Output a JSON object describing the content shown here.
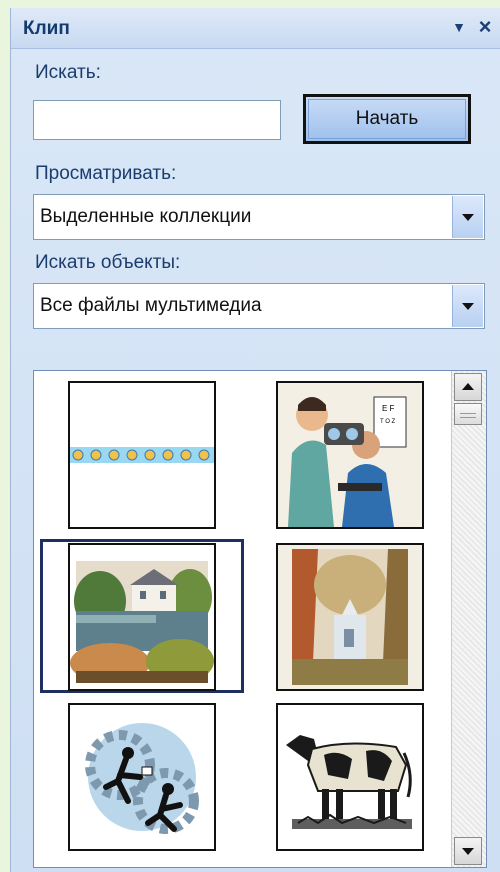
{
  "pane": {
    "title": "Клип",
    "menu_icon": "dropdown-triangle-icon",
    "close_icon": "close-x-icon"
  },
  "search": {
    "label": "Искать:",
    "value": "",
    "button_label": "Начать"
  },
  "browse": {
    "label": "Просматривать:",
    "selected": "Выделенные коллекции"
  },
  "find_objects": {
    "label": "Искать объекты:",
    "selected": "Все файлы мультимедиа"
  },
  "results": [
    {
      "name": "clip-dotted-border"
    },
    {
      "name": "clip-eye-exam"
    },
    {
      "name": "clip-house-by-lake"
    },
    {
      "name": "clip-chapel-in-trees"
    },
    {
      "name": "clip-gears-figures"
    },
    {
      "name": "clip-cow"
    }
  ],
  "colors": {
    "accent_border": "#1e3060",
    "pane_bg": "#d9e7f7",
    "title_text": "#153a6e"
  }
}
